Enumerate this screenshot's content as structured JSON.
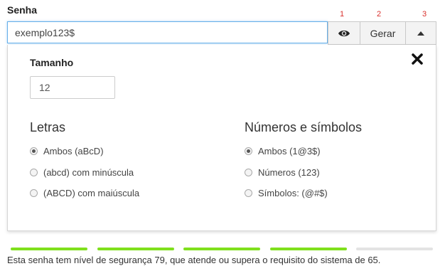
{
  "field": {
    "label": "Senha"
  },
  "markers": [
    "1",
    "2",
    "3"
  ],
  "password": {
    "value": "exemplo123$"
  },
  "buttons": {
    "eye_icon": "eye-icon",
    "generate_label": "Gerar",
    "toggle_icon": "caret-up-icon"
  },
  "panel": {
    "close_icon": "close-icon",
    "size_label": "Tamanho",
    "size_value": "12",
    "letters": {
      "title": "Letras",
      "options": [
        {
          "label": "Ambos (aBcD)",
          "selected": true
        },
        {
          "label": "(abcd) com minúscula",
          "selected": false
        },
        {
          "label": "(ABCD) com maiúscula",
          "selected": false
        }
      ]
    },
    "numbers_symbols": {
      "title": "Números e símbolos",
      "options": [
        {
          "label": "Ambos (1@3$)",
          "selected": true
        },
        {
          "label": "Números (123)",
          "selected": false
        },
        {
          "label": "Símbolos: (@#$)",
          "selected": false
        }
      ]
    }
  },
  "strength": {
    "segments_filled": 4,
    "segments_total": 5,
    "filled_color": "#7fe01d",
    "empty_color": "#e3e3e3",
    "message": "Esta senha tem nível de segurança 79, que atende ou supera o requisito do sistema de 65."
  }
}
